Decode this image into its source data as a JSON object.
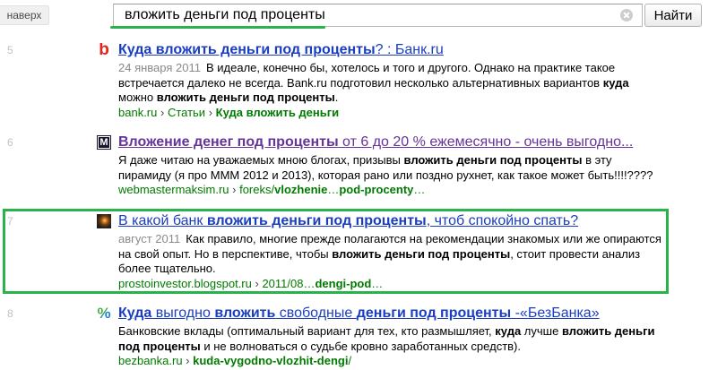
{
  "colors": {
    "link": "#1a3dc1",
    "visited": "#663399",
    "url": "#007a00",
    "muted": "#8a8a8a",
    "highlight": "#28b44a"
  },
  "header": {
    "top_link": "наверх",
    "search_value": "вложить деньги под проценты",
    "search_button": "Найти",
    "clear_icon": "clear-icon"
  },
  "results": [
    {
      "number": "5",
      "favicon": {
        "icon": "bank-ru-favicon-icon",
        "glyph": "b"
      },
      "visited": false,
      "title": [
        {
          "t": "Куда вложить деньги под проценты",
          "b": true
        },
        {
          "t": "? : Банк.ru"
        }
      ],
      "date": "24 января 2011",
      "snippet_lines": [
        [
          {
            "t": "В идеале, конечно бы, хотелось и того и другого. Однако на практике такое"
          }
        ],
        [
          {
            "t": "встречается далеко не всегда. Bank.ru подготовил несколько альтернативных вариантов "
          },
          {
            "t": "куда",
            "b": true
          }
        ],
        [
          {
            "t": "можно "
          },
          {
            "t": "вложить деньги под проценты",
            "b": true
          },
          {
            "t": "."
          }
        ]
      ],
      "url": [
        {
          "t": "bank.ru"
        },
        {
          "t": " › ",
          "sep": true
        },
        {
          "t": "Статьи"
        },
        {
          "t": " › ",
          "sep": true
        },
        {
          "t": "Куда вложить деньги",
          "b": true
        }
      ]
    },
    {
      "number": "6",
      "favicon": {
        "icon": "webmastermaksim-favicon-icon",
        "glyph": "M"
      },
      "visited": true,
      "title": [
        {
          "t": "Вложение денег под проценты",
          "b": true
        },
        {
          "t": " от 6 до 20 % ежемесячно - очень выгодно..."
        }
      ],
      "snippet_lines": [
        [
          {
            "t": "Я даже читаю на уважаемых мною блогах, призывы "
          },
          {
            "t": "вложить деньги под проценты",
            "b": true
          },
          {
            "t": " в эту"
          }
        ],
        [
          {
            "t": "пирамиду (я про МММ 2012 и 2013), которая рано или поздно рухнет, как такое может быть!!!!????"
          }
        ]
      ],
      "url": [
        {
          "t": "webmastermaksim.ru"
        },
        {
          "t": " › ",
          "sep": true
        },
        {
          "t": "foreks/"
        },
        {
          "t": "vlozhenie",
          "b": true
        },
        {
          "t": "…"
        },
        {
          "t": "pod-procenty",
          "b": true
        },
        {
          "t": "…"
        }
      ]
    },
    {
      "number": "7",
      "favicon": {
        "icon": "prostoinvestor-favicon-icon"
      },
      "visited": false,
      "title": [
        {
          "t": "В какой банк "
        },
        {
          "t": "вложить деньги под проценты",
          "b": true
        },
        {
          "t": ", чтоб спокойно спать?"
        }
      ],
      "date": "август 2011",
      "snippet_lines": [
        [
          {
            "t": "Как правило, многие прежде полагаются на рекомендации знакомых или же опираются"
          }
        ],
        [
          {
            "t": "на свой опыт. Но в перспективе, чтобы "
          },
          {
            "t": "вложить деньги под проценты",
            "b": true
          },
          {
            "t": ", стоит провести анализ"
          }
        ],
        [
          {
            "t": "более тщательно."
          }
        ]
      ],
      "url": [
        {
          "t": "prostoinvestor.blogspot.ru"
        },
        {
          "t": " › ",
          "sep": true
        },
        {
          "t": "2011/08…"
        },
        {
          "t": "dengi-pod",
          "b": true
        },
        {
          "t": "…"
        }
      ]
    },
    {
      "number": "8",
      "favicon": {
        "icon": "bezbanka-favicon-icon",
        "glyph": "%"
      },
      "visited": false,
      "title": [
        {
          "t": "Куда",
          "b": true
        },
        {
          "t": " выгодно "
        },
        {
          "t": "вложить",
          "b": true
        },
        {
          "t": " свободные "
        },
        {
          "t": "деньги под проценты",
          "b": true
        },
        {
          "t": " -«БезБанка»"
        }
      ],
      "snippet_lines": [
        [
          {
            "t": "Банковские вклады (оптимальный вариант для тех, кто размышляет, "
          },
          {
            "t": "куда",
            "b": true
          },
          {
            "t": " лучше "
          },
          {
            "t": "вложить деньги",
            "b": true
          }
        ],
        [
          {
            "t": "под проценты",
            "b": true
          },
          {
            "t": " и не волноваться о судьбе кровно заработанных средств)."
          }
        ]
      ],
      "url": [
        {
          "t": "bezbanka.ru"
        },
        {
          "t": " › ",
          "sep": true
        },
        {
          "t": "kuda-vygodno-vlozhit-dengi",
          "b": true
        },
        {
          "t": "/"
        }
      ]
    }
  ]
}
